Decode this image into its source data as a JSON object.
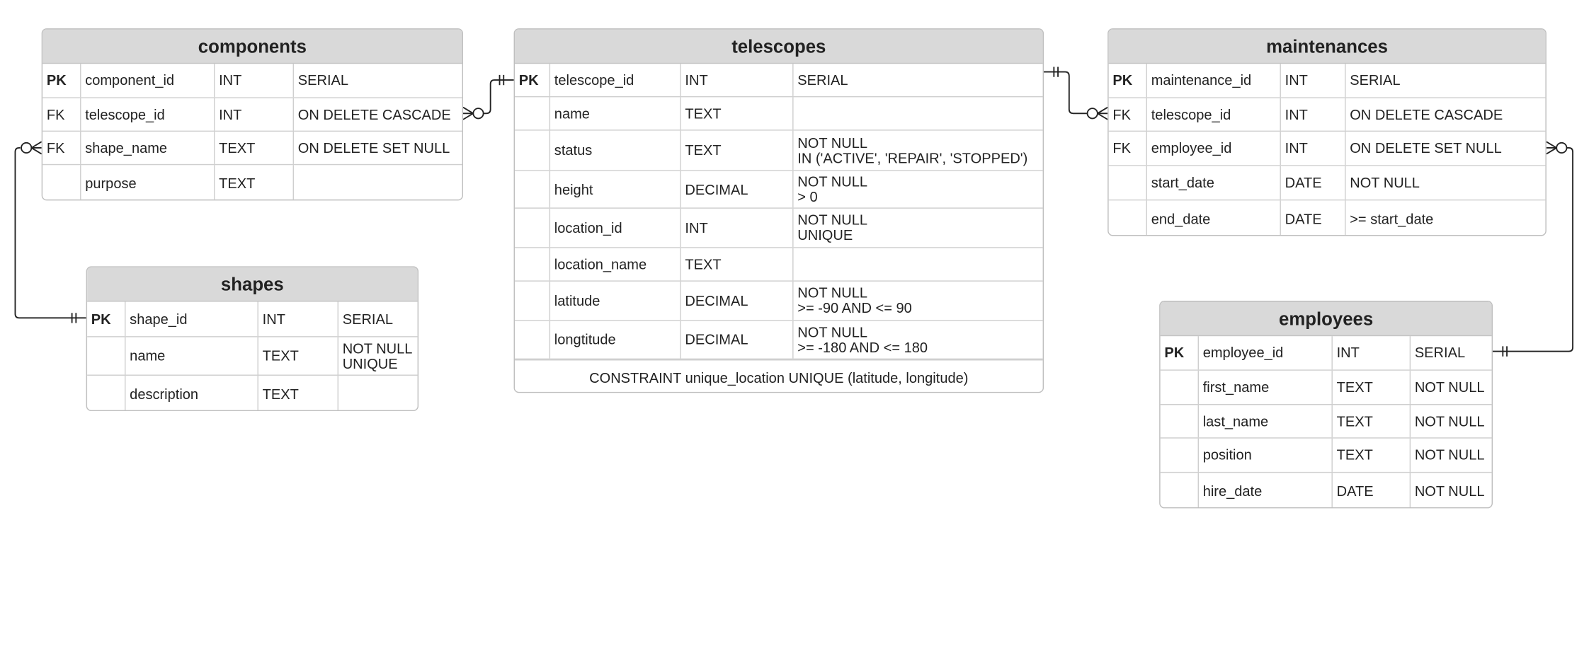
{
  "entities": [
    {
      "id": "components",
      "title": "components",
      "rows": [
        [
          "PK",
          "component_id",
          "INT",
          "SERIAL"
        ],
        [
          "FK",
          "telescope_id",
          "INT",
          "ON DELETE CASCADE"
        ],
        [
          "FK",
          "shape_name",
          "TEXT",
          "ON DELETE SET NULL"
        ],
        [
          "",
          "purpose",
          "TEXT",
          ""
        ]
      ]
    },
    {
      "id": "telescopes",
      "title": "telescopes",
      "rows": [
        [
          "PK",
          "telescope_id",
          "INT",
          "SERIAL"
        ],
        [
          "",
          "name",
          "TEXT",
          ""
        ],
        [
          "",
          "status",
          "TEXT",
          "NOT NULL\nIN ('ACTIVE', 'REPAIR', 'STOPPED')"
        ],
        [
          "",
          "height",
          "DECIMAL",
          "NOT NULL\n> 0"
        ],
        [
          "",
          "location_id",
          "INT",
          "NOT NULL\nUNIQUE"
        ],
        [
          "",
          "location_name",
          "TEXT",
          ""
        ],
        [
          "",
          "latitude",
          "DECIMAL",
          "NOT NULL\n>= -90 AND <= 90"
        ],
        [
          "",
          "longtitude",
          "DECIMAL",
          "NOT NULL\n>= -180 AND <= 180"
        ]
      ],
      "footer": "CONSTRAINT unique_location UNIQUE (latitude, longitude)"
    },
    {
      "id": "maintenances",
      "title": "maintenances",
      "rows": [
        [
          "PK",
          "maintenance_id",
          "INT",
          "SERIAL"
        ],
        [
          "FK",
          "telescope_id",
          "INT",
          "ON DELETE CASCADE"
        ],
        [
          "FK",
          "employee_id",
          "INT",
          "ON DELETE SET NULL"
        ],
        [
          "",
          "start_date",
          "DATE",
          "NOT NULL"
        ],
        [
          "",
          "end_date",
          "DATE",
          ">= start_date"
        ]
      ]
    },
    {
      "id": "shapes",
      "title": "shapes",
      "rows": [
        [
          "PK",
          "shape_id",
          "INT",
          "SERIAL"
        ],
        [
          "",
          "name",
          "TEXT",
          "NOT NULL\nUNIQUE"
        ],
        [
          "",
          "description",
          "TEXT",
          ""
        ]
      ]
    },
    {
      "id": "employees",
      "title": "employees",
      "rows": [
        [
          "PK",
          "employee_id",
          "INT",
          "SERIAL"
        ],
        [
          "",
          "first_name",
          "TEXT",
          "NOT NULL"
        ],
        [
          "",
          "last_name",
          "TEXT",
          "NOT NULL"
        ],
        [
          "",
          "position",
          "TEXT",
          "NOT NULL"
        ],
        [
          "",
          "hire_date",
          "DATE",
          "NOT NULL"
        ]
      ]
    }
  ],
  "relationships": [
    {
      "from": "components.telescope_id",
      "to": "telescopes.telescope_id",
      "from_end": "zero-or-many",
      "to_end": "exactly-one"
    },
    {
      "from": "components.shape_name",
      "to": "shapes.shape_id",
      "from_end": "zero-or-many",
      "to_end": "exactly-one"
    },
    {
      "from": "maintenances.telescope_id",
      "to": "telescopes.telescope_id",
      "from_end": "zero-or-many",
      "to_end": "exactly-one"
    },
    {
      "from": "maintenances.employee_id",
      "to": "employees.employee_id",
      "from_end": "zero-or-many",
      "to_end": "exactly-one"
    }
  ],
  "colors": {
    "header": "#d9d9d9",
    "border": "#bfbfbf",
    "line": "#222222"
  }
}
